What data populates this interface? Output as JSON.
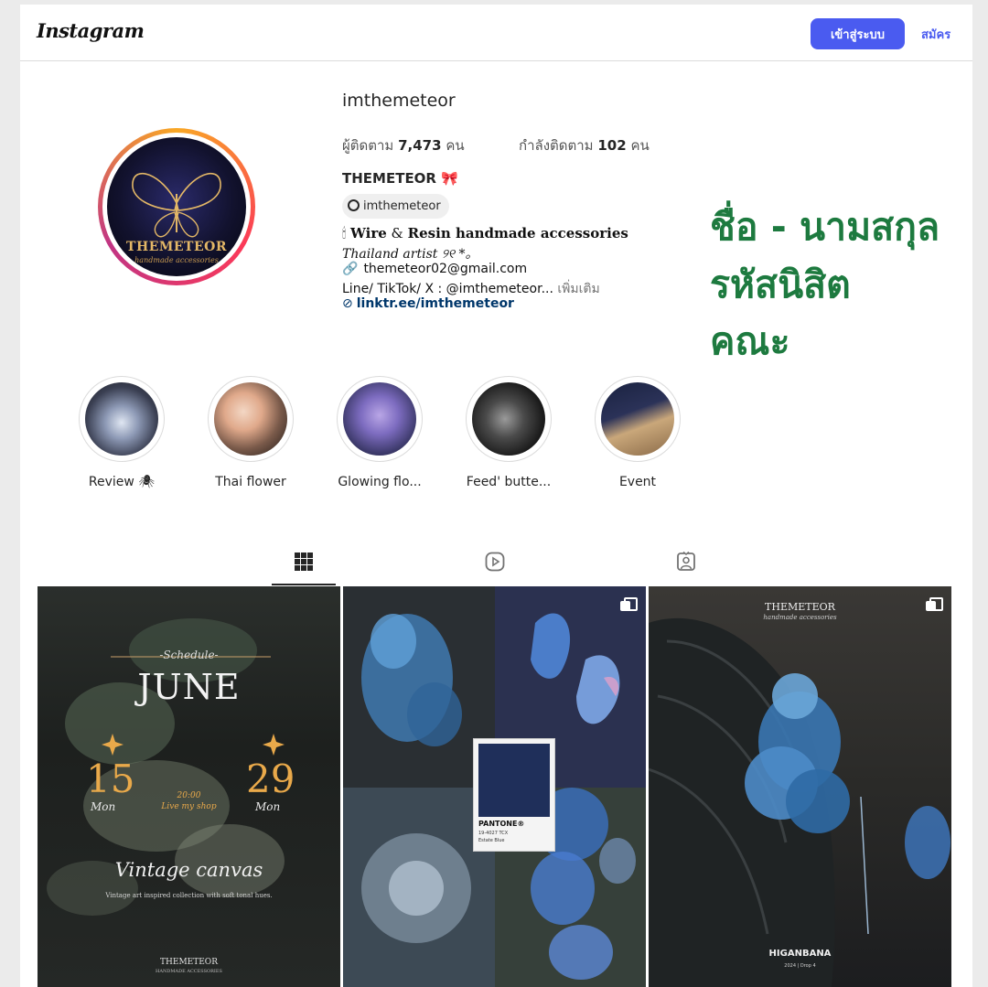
{
  "header": {
    "logo": "Instagram",
    "login_label": "เข้าสู่ระบบ",
    "signup_label": "สมัคร",
    "accent_color": "#4a5bf0"
  },
  "profile": {
    "avatar_brand": "THEMETEOR",
    "avatar_sub": "handmade accessories",
    "username": "imthemeteor",
    "followers_prefix": "ผู้ติดตาม",
    "followers_count": "7,473",
    "followers_suffix": "คน",
    "following_prefix": "กำลังติดตาม",
    "following_count": "102",
    "following_suffix": "คน",
    "display_name": "THEMETEOR 🎀",
    "threads_handle": "imthemeteor",
    "bio_line1_icon": "🕯",
    "bio_line1_a": "Wire",
    "bio_line1_amp": " & ",
    "bio_line1_b": "Resin handmade accessories",
    "bio_line2": "Thailand artist ୨୧ *。",
    "bio_line3": "themeteor02@gmail.com",
    "bio_line4": "Line/ TikTok/ X : @imthemeteor...",
    "bio_more": " เพิ่มเติม",
    "bio_link": "linktr.ee/imthemeteor"
  },
  "overlay": {
    "line1": "ชื่อ - นามสกุล",
    "line2": "รหัสนิสิต",
    "line3": "คณะ",
    "color": "#1d7a3f"
  },
  "highlights": [
    {
      "label": "Review 🕷"
    },
    {
      "label": "Thai flower"
    },
    {
      "label": "Glowing flo..."
    },
    {
      "label": "Feed' butte..."
    },
    {
      "label": "Event"
    }
  ],
  "tabs": {
    "posts": "grid-icon",
    "reels": "reels-icon",
    "tagged": "tagged-icon"
  },
  "posts": {
    "p0": {
      "schedule": "-Schedule-",
      "month": "JUNE",
      "day1": "15",
      "day2": "29",
      "mon1": "Mon",
      "mon2": "Mon",
      "time": "20:00",
      "live": "Live my shop",
      "title": "Vintage canvas",
      "desc": "Vintage art inspired collection with soft tonal hues.",
      "brand": "THEMETEOR",
      "brand_sub": "HANDMADE ACCESSORIES"
    },
    "p1": {
      "pantone_name": "PANTONE®",
      "pantone_code": "19-4027 TCX",
      "pantone_color": "Estate Blue"
    },
    "p2": {
      "brand": "THEMETEOR",
      "brand_sub": "handmade accessories",
      "title": "HIGANBANA",
      "sub": "2024 | Drop 4"
    }
  }
}
